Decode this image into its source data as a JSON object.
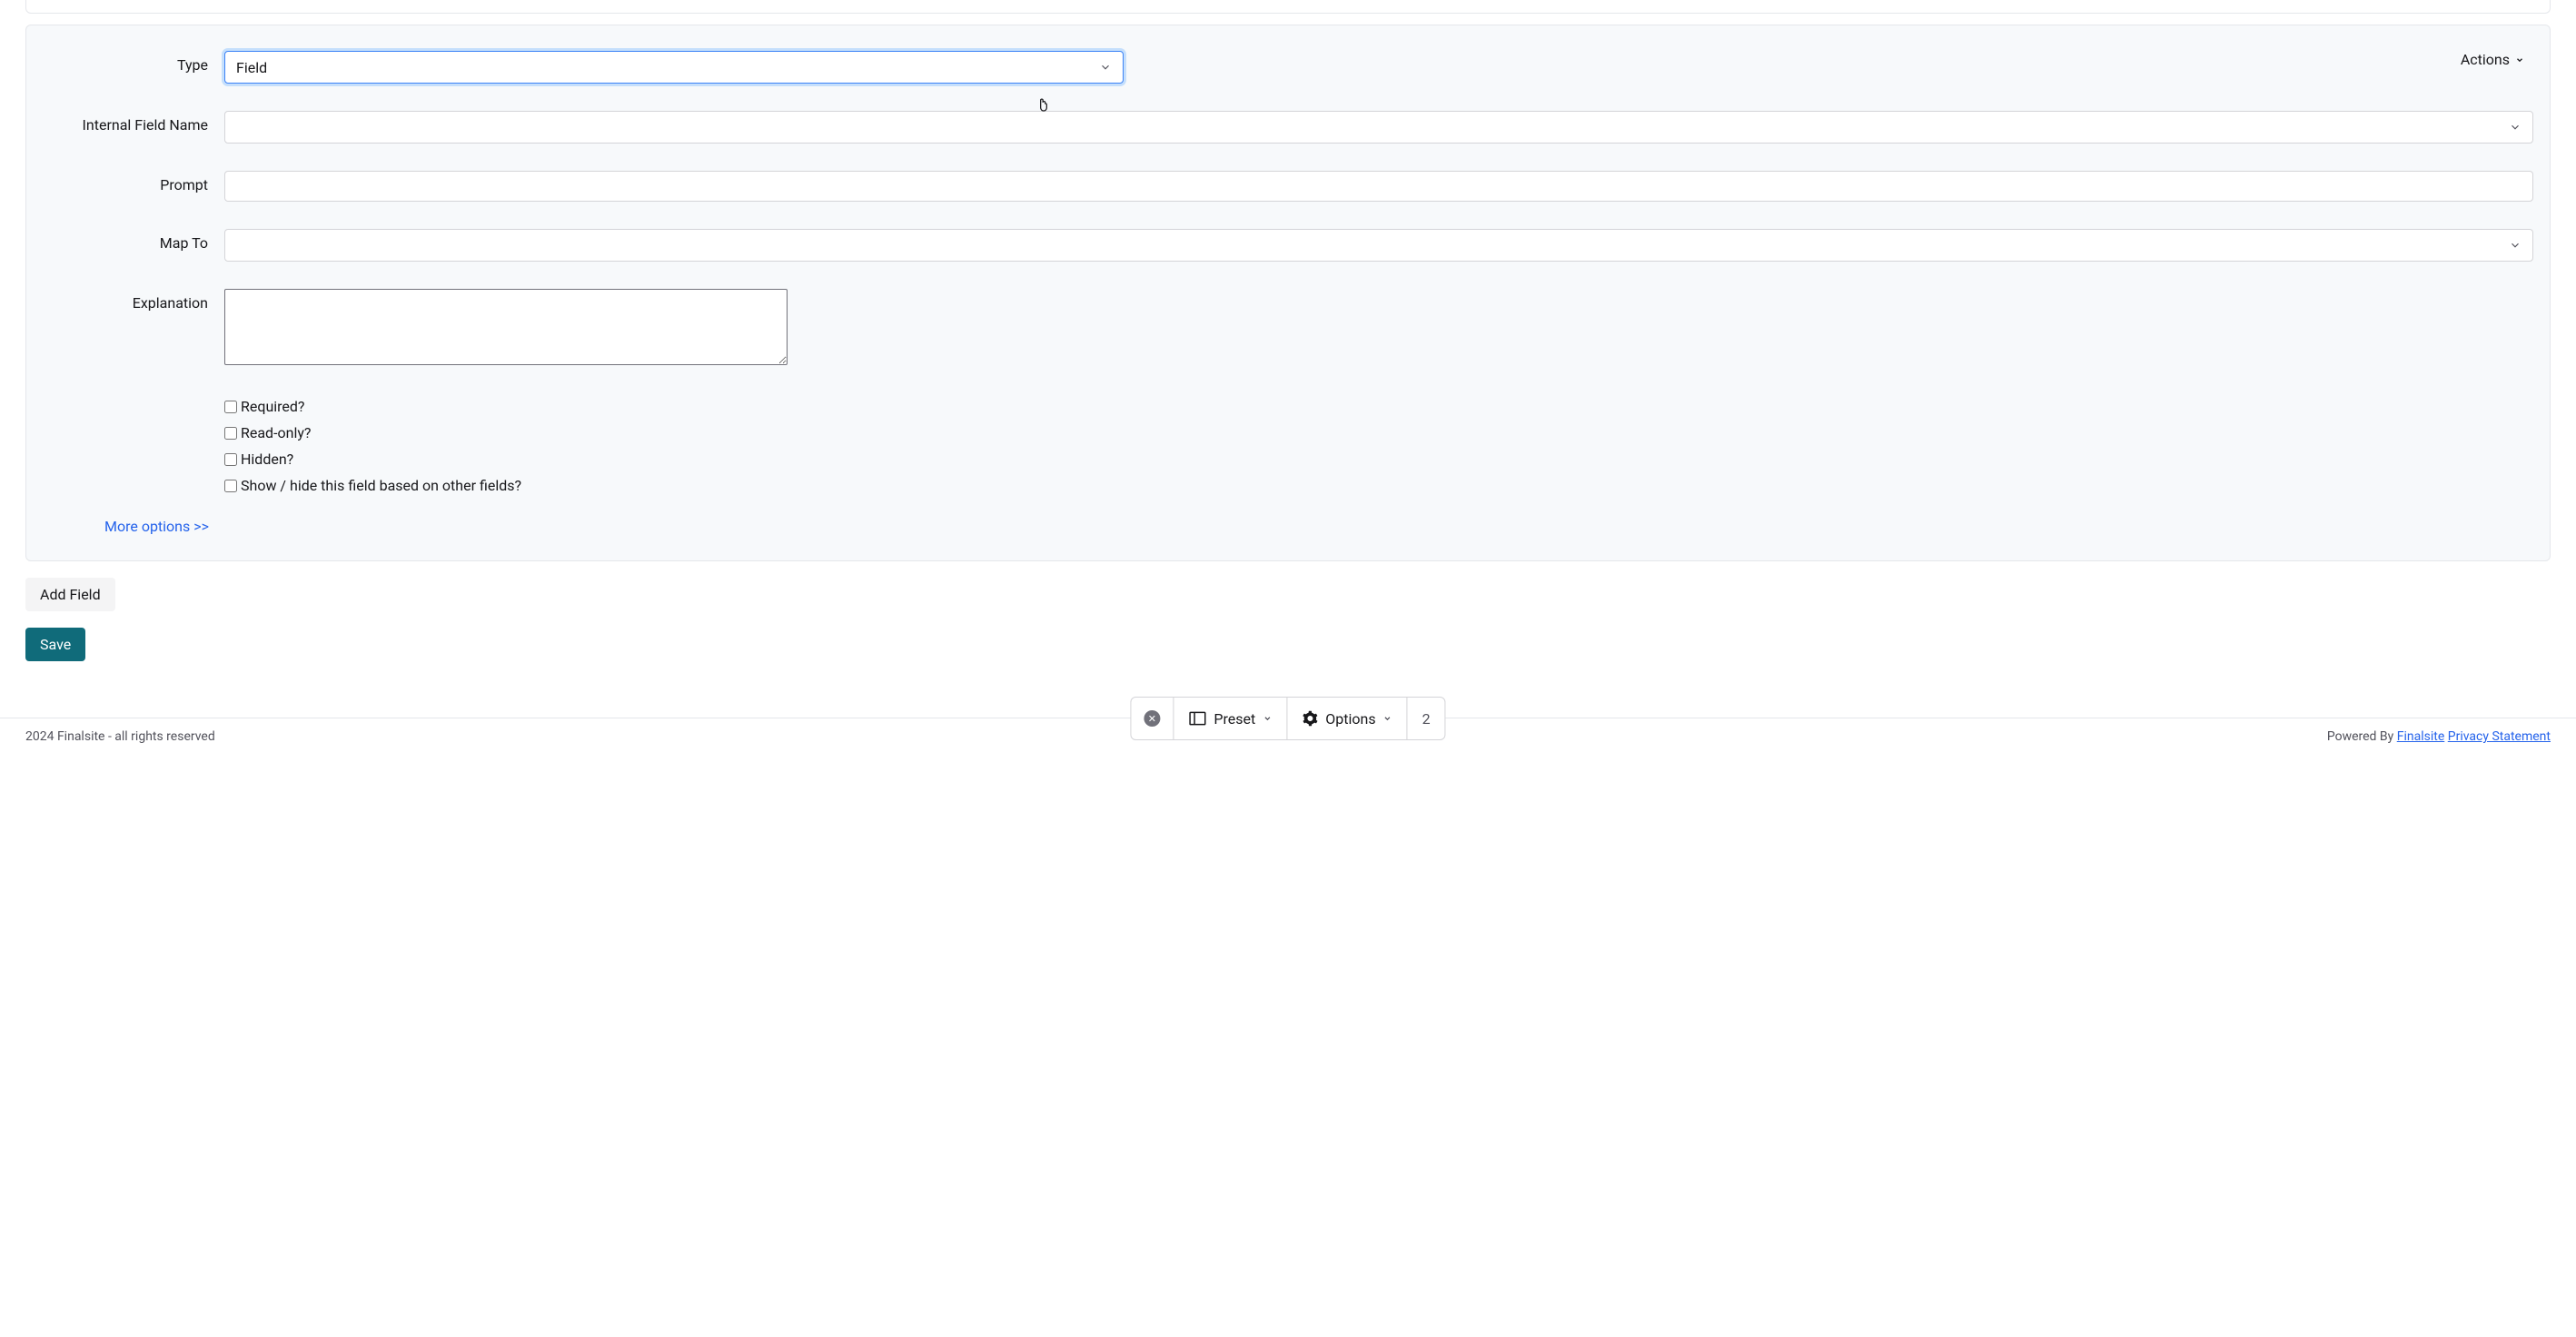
{
  "form": {
    "type": {
      "label": "Type",
      "value": "Field"
    },
    "internal_field_name": {
      "label": "Internal Field Name",
      "value": ""
    },
    "prompt": {
      "label": "Prompt",
      "value": ""
    },
    "map_to": {
      "label": "Map To",
      "value": ""
    },
    "explanation": {
      "label": "Explanation",
      "value": ""
    },
    "checkboxes": {
      "required": {
        "label": "Required?",
        "checked": false
      },
      "readonly": {
        "label": "Read-only?",
        "checked": false
      },
      "hidden": {
        "label": "Hidden?",
        "checked": false
      },
      "showhide": {
        "label": "Show / hide this field based on other fields?",
        "checked": false
      }
    },
    "more_options": "More options >>",
    "actions": "Actions"
  },
  "buttons": {
    "add_field": "Add Field",
    "save": "Save"
  },
  "toolbar": {
    "preset": "Preset",
    "options": "Options",
    "page": "2"
  },
  "footer": {
    "copyright": "2024 Finalsite - all rights reserved",
    "powered_by": "Powered By ",
    "finalsite": "Finalsite",
    "privacy": "Privacy Statement"
  }
}
